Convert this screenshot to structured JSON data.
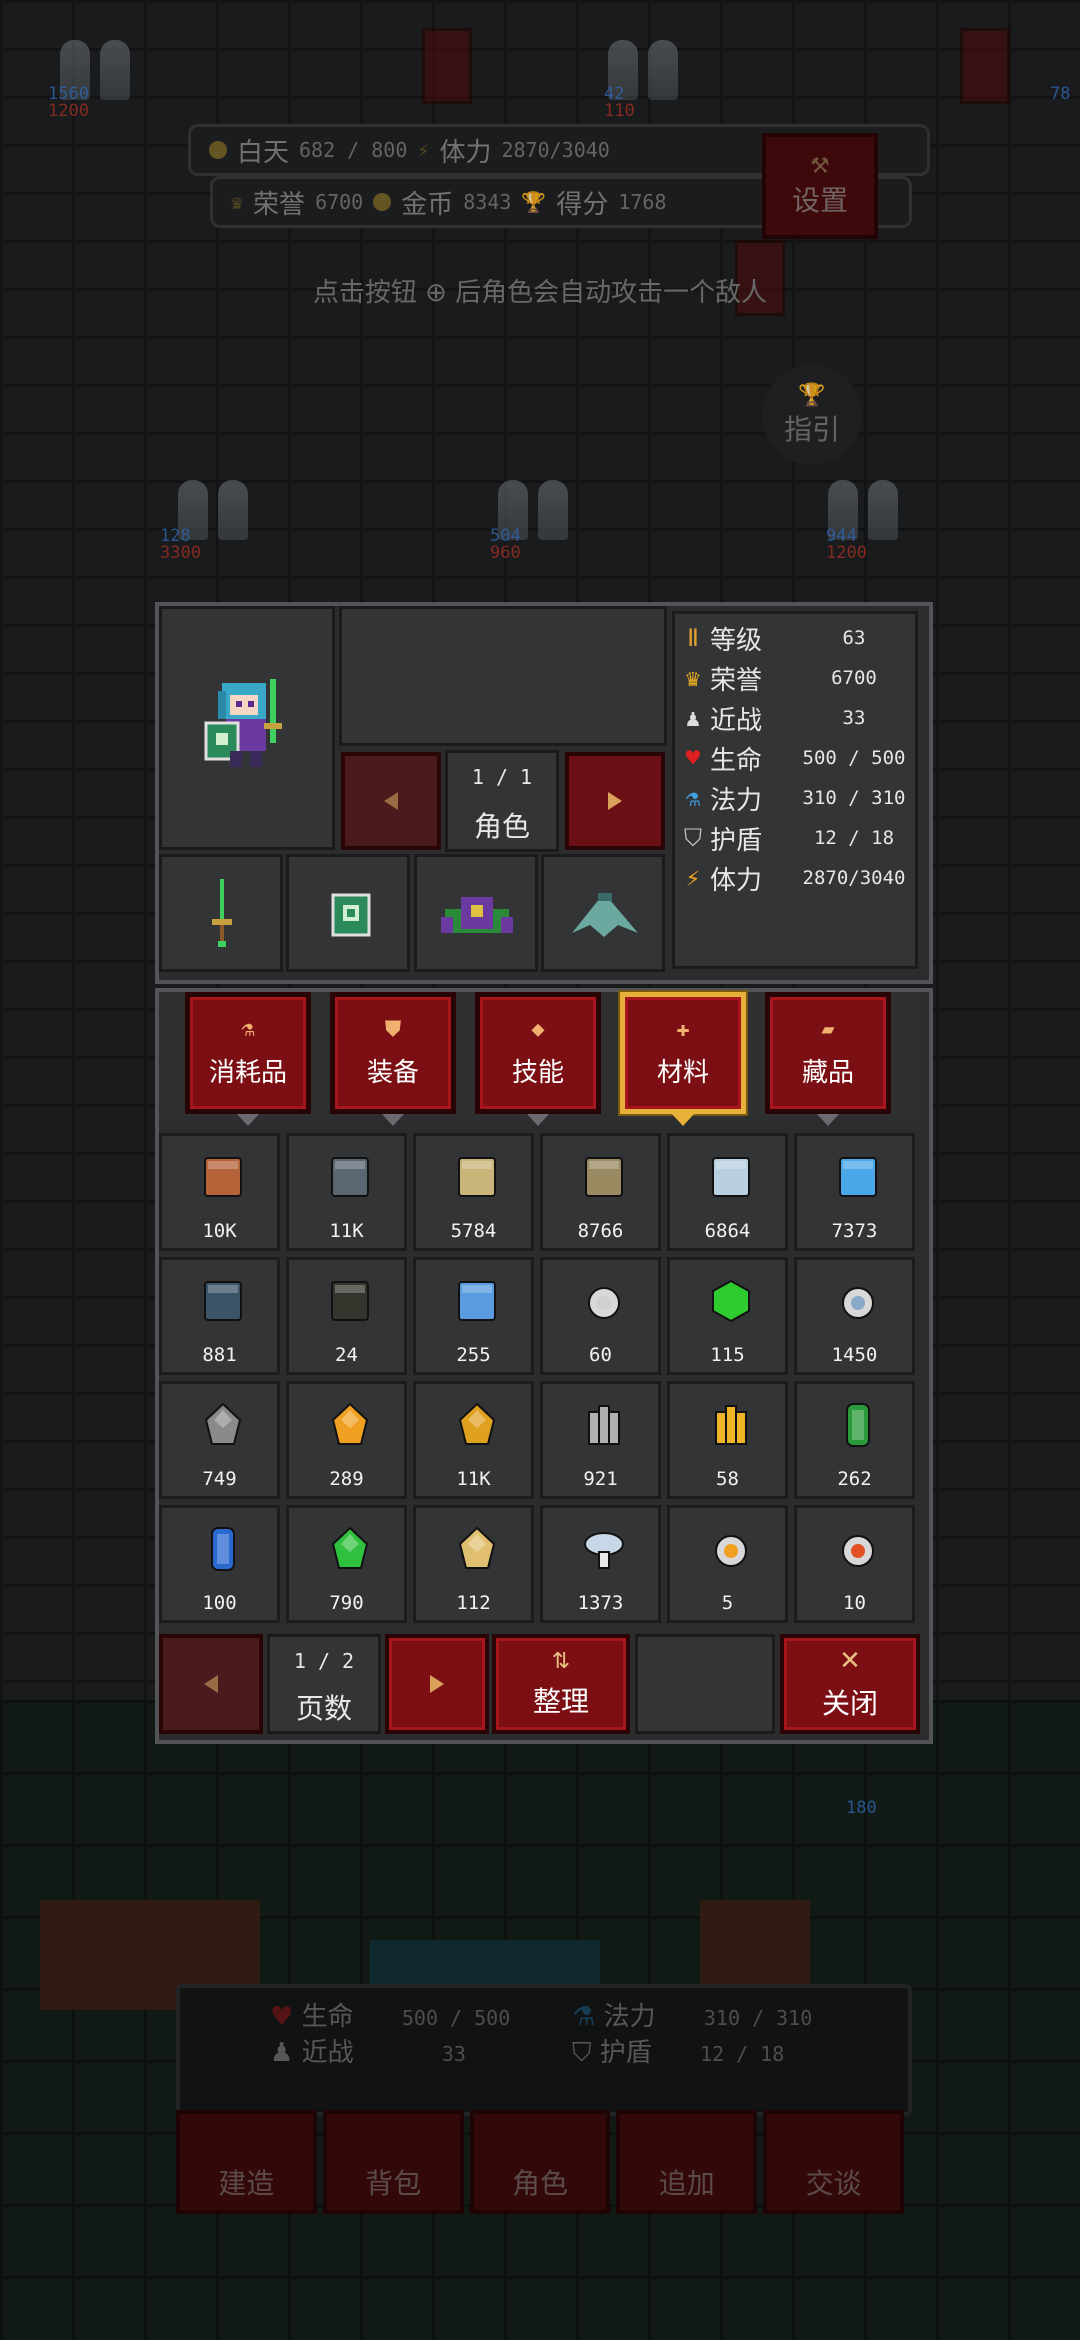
{
  "hud": {
    "day_label": "白天",
    "day_value": "682 / 800",
    "stamina_label": "体力",
    "stamina_value": "2870/3040",
    "honor_label": "荣誉",
    "honor_value": "6700",
    "gold_label": "金币",
    "gold_value": "8343",
    "score_label": "得分",
    "score_value": "1768",
    "settings_label": "设置",
    "guide_label": "指引"
  },
  "hint": {
    "before": "点击按钮",
    "after": "后角色会自动攻击一个敌人"
  },
  "bg_units": [
    {
      "a": "1560",
      "b": "1200"
    },
    {
      "a": "42",
      "b": "110"
    },
    {
      "a": "78",
      "b": ""
    },
    {
      "a": "128",
      "b": "3300"
    },
    {
      "a": "504",
      "b": "960"
    },
    {
      "a": "944",
      "b": "1200"
    },
    {
      "a": "180",
      "b": ""
    }
  ],
  "character": {
    "page": "1 / 1",
    "page_label": "角色",
    "equipment_icons": [
      "sword-icon",
      "spellbook-icon",
      "armor-icon",
      "cape-icon"
    ]
  },
  "stats": [
    {
      "icon": "level-icon",
      "name": "等级",
      "value": "63",
      "color": "#e0a030"
    },
    {
      "icon": "crown-icon",
      "name": "荣誉",
      "value": "6700",
      "color": "#f0b020"
    },
    {
      "icon": "melee-icon",
      "name": "近战",
      "value": "33",
      "color": "#dcdcdc"
    },
    {
      "icon": "heart-icon",
      "name": "生命",
      "value": "500 / 500",
      "color": "#e02020"
    },
    {
      "icon": "potion-icon",
      "name": "法力",
      "value": "310 / 310",
      "color": "#40a0e0"
    },
    {
      "icon": "shield-icon",
      "name": "护盾",
      "value": "12 / 18",
      "color": "#c8c8c8"
    },
    {
      "icon": "lightning-icon",
      "name": "体力",
      "value": "2870/3040",
      "color": "#f0a020"
    }
  ],
  "tabs": [
    {
      "label": "消耗品",
      "icon": "flask-icon",
      "active": false
    },
    {
      "label": "装备",
      "icon": "shield-tab-icon",
      "active": false
    },
    {
      "label": "技能",
      "icon": "diamond-icon",
      "active": false
    },
    {
      "label": "材料",
      "icon": "cross-icon",
      "active": true
    },
    {
      "label": "藏品",
      "icon": "scroll-icon",
      "active": false
    }
  ],
  "items": [
    {
      "icon": "copper-block-icon",
      "count": "10K",
      "color": "#b5643a"
    },
    {
      "icon": "iron-block-icon",
      "count": "11K",
      "color": "#5a6672"
    },
    {
      "icon": "sand-block-icon",
      "count": "5784",
      "color": "#c9b57a"
    },
    {
      "icon": "rock-block-icon",
      "count": "8766",
      "color": "#9a8a62"
    },
    {
      "icon": "glass-block-icon",
      "count": "6864",
      "color": "#b8d0e0"
    },
    {
      "icon": "ice-block-icon",
      "count": "7373",
      "color": "#4aa8e8"
    },
    {
      "icon": "stone-brick-icon",
      "count": "881",
      "color": "#3c5468"
    },
    {
      "icon": "dark-block-icon",
      "count": "24",
      "color": "#34362e"
    },
    {
      "icon": "crystal-block-icon",
      "count": "255",
      "color": "#5a9be0"
    },
    {
      "icon": "jar-icon",
      "count": "60",
      "color": "#d0d0d0"
    },
    {
      "icon": "emerald-cube-icon",
      "count": "115",
      "color": "#2ecc2e"
    },
    {
      "icon": "gear-orb-icon",
      "count": "1450",
      "color": "#8aa8c8"
    },
    {
      "icon": "ore-icon",
      "count": "749",
      "color": "#8a8a8a"
    },
    {
      "icon": "gold-ore-icon",
      "count": "289",
      "color": "#f0a020"
    },
    {
      "icon": "amber-shard-icon",
      "count": "11K",
      "color": "#e0a020"
    },
    {
      "icon": "silver-ingot-icon",
      "count": "921",
      "color": "#b0b0b0"
    },
    {
      "icon": "gold-ingot-icon",
      "count": "58",
      "color": "#f0b428"
    },
    {
      "icon": "emerald-gem-icon",
      "count": "262",
      "color": "#2a9a3a"
    },
    {
      "icon": "sapphire-gem-icon",
      "count": "100",
      "color": "#2a6ad0"
    },
    {
      "icon": "green-crystal-icon",
      "count": "790",
      "color": "#30c040"
    },
    {
      "icon": "topaz-crystal-icon",
      "count": "112",
      "color": "#e0c070"
    },
    {
      "icon": "mushroom-icon",
      "count": "1373",
      "color": "#c8d8e8"
    },
    {
      "icon": "token-icon",
      "count": "5",
      "color": "#f0a020"
    },
    {
      "icon": "token-red-icon",
      "count": "10",
      "color": "#e05020"
    }
  ],
  "footer": {
    "page": "1 / 2",
    "page_label": "页数",
    "sort_label": "整理",
    "close_label": "关闭"
  },
  "bottom": {
    "hp_label": "生命",
    "hp_value": "500 / 500",
    "mp_label": "法力",
    "mp_value": "310 / 310",
    "melee_label": "近战",
    "melee_value": "33",
    "shield_label": "护盾",
    "shield_value": "12 / 18",
    "nav": [
      "建造",
      "背包",
      "角色",
      "追加",
      "交谈"
    ]
  }
}
